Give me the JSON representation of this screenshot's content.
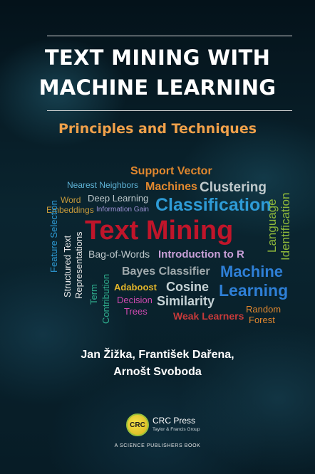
{
  "cover": {
    "title_line1": "TEXT MINING WITH",
    "title_line2": "MACHINE LEARNING",
    "subtitle": "Principles and Techniques",
    "authors_line1": "Jan Žižka, František Dařena,",
    "authors_line2": "Arnošt Svoboda",
    "publisher": {
      "logo_mark": "CRC",
      "name": "CRC Press",
      "group": "Taylor & Francis Group",
      "imprint": "A SCIENCE PUBLISHERS BOOK"
    },
    "colors": {
      "background": "#0a2530",
      "title": "#ffffff",
      "subtitle": "#f0a04a",
      "rule": "#d9d9d9"
    }
  },
  "word_cloud": {
    "support_vector": "Support Vector",
    "machines": "Machines",
    "nearest_neighbors": "Nearest Neighbors",
    "clustering": "Clustering",
    "word": "Word",
    "deep_learning": "Deep Learning",
    "embeddings": "Embeddings",
    "information_gain": "Information Gain",
    "classification": "Classification",
    "language": "Language",
    "identification": "Identification",
    "feature_selection": "Feature Selection",
    "structured_text": "Structured Text",
    "representations": "Representations",
    "text_mining": "Text Mining",
    "bag_of_words": "Bag-of-Words",
    "introduction_to_r": "Introduction to R",
    "bayes_classifier": "Bayes Classifier",
    "machine": "Machine",
    "learning": "Learning",
    "term": "Term",
    "contribution": "Contribution",
    "adaboost": "Adaboost",
    "cosine": "Cosine",
    "similarity": "Similarity",
    "decision": "Decision",
    "trees": "Trees",
    "weak_learners": "Weak Learners",
    "random": "Random",
    "forest": "Forest"
  }
}
